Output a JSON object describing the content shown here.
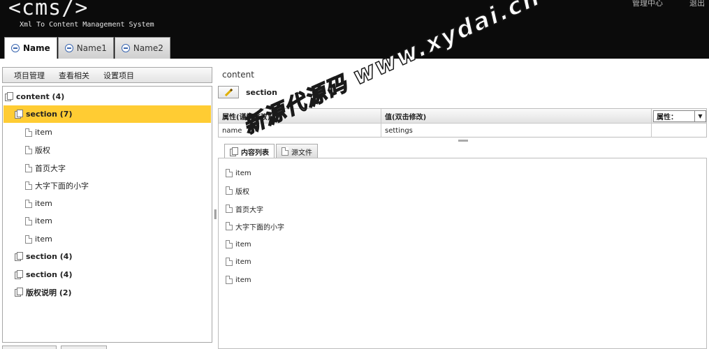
{
  "header": {
    "logo": "<cms/>",
    "tagline": "Xml To Content Management System",
    "links": [
      "管理中心",
      "退出"
    ],
    "tabs": [
      "Name",
      "Name1",
      "Name2"
    ]
  },
  "menubar": [
    "项目管理",
    "查看相关",
    "设置项目"
  ],
  "tree": [
    {
      "label": "content (4)",
      "level": 0,
      "icon": "documents-icon",
      "bold": true
    },
    {
      "label": "section (7)",
      "level": 1,
      "icon": "documents-icon",
      "bold": true,
      "selected": true
    },
    {
      "label": "item",
      "level": 2,
      "icon": "document-icon"
    },
    {
      "label": "版权",
      "level": 2,
      "icon": "document-icon"
    },
    {
      "label": "首页大字",
      "level": 2,
      "icon": "document-icon"
    },
    {
      "label": "大字下面的小字",
      "level": 2,
      "icon": "document-icon"
    },
    {
      "label": "item",
      "level": 2,
      "icon": "document-icon"
    },
    {
      "label": "item",
      "level": 2,
      "icon": "document-icon"
    },
    {
      "label": "item",
      "level": 2,
      "icon": "document-icon"
    },
    {
      "label": "section (4)",
      "level": 1,
      "icon": "documents-icon",
      "bold": true
    },
    {
      "label": "section (4)",
      "level": 1,
      "icon": "documents-icon",
      "bold": true
    },
    {
      "label": "版权说明 (2)",
      "level": 1,
      "icon": "documents-icon",
      "bold": true
    }
  ],
  "main": {
    "breadcrumb": "content",
    "edit_label": "section",
    "grid": {
      "headers": [
        "属性(谨慎修改)",
        "值(双击修改)"
      ],
      "attr_select": "属性：",
      "row": [
        "name",
        "settings"
      ]
    },
    "subtabs": [
      "内容列表",
      "源文件"
    ],
    "list": [
      "item",
      "版权",
      "首页大字",
      "大字下面的小字",
      "item",
      "item",
      "item"
    ]
  },
  "watermark": {
    "line1": "新源代源码",
    "line2": "www.xydai.cn"
  }
}
